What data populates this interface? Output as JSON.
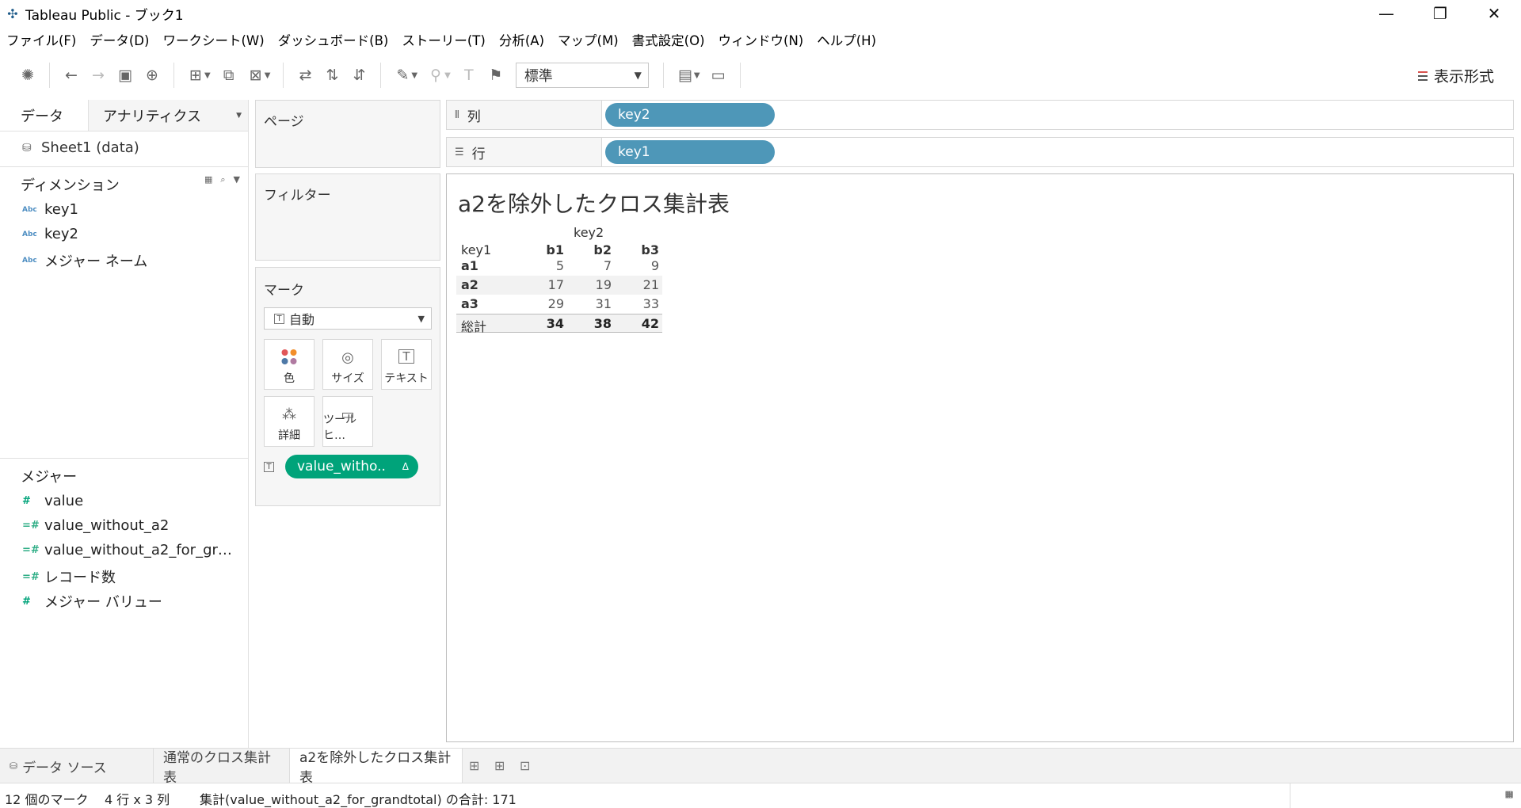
{
  "window": {
    "title": "Tableau Public - ブック1",
    "minimize": "—",
    "restore": "❐",
    "close": "✕"
  },
  "menu": [
    "ファイル(F)",
    "データ(D)",
    "ワークシート(W)",
    "ダッシュボード(B)",
    "ストーリー(T)",
    "分析(A)",
    "マップ(M)",
    "書式設定(O)",
    "ウィンドウ(N)",
    "ヘルプ(H)"
  ],
  "toolbar": {
    "fit_select": "標準",
    "format_label": "表示形式"
  },
  "left_pane": {
    "tabs": [
      "データ",
      "アナリティクス"
    ],
    "datasource": "Sheet1 (data)",
    "dimensions_header": "ディメンション",
    "dimensions": [
      "key1",
      "key2",
      "メジャー ネーム"
    ],
    "abc_badge": "Abc",
    "measures_header": "メジャー",
    "measures": [
      "value",
      "value_without_a2",
      "value_without_a2_for_gr…",
      "レコード数",
      "メジャー バリュー"
    ]
  },
  "cards": {
    "pages": "ページ",
    "filters": "フィルター",
    "marks": "マーク",
    "marks_type": "自動",
    "mark_buttons": [
      "色",
      "サイズ",
      "テキスト",
      "詳細",
      "ツールヒ…"
    ],
    "text_pill": "value_witho..",
    "pill_delta": "Δ"
  },
  "shelves": {
    "columns_label": "列",
    "rows_label": "行",
    "columns_pill": "key2",
    "rows_pill": "key1"
  },
  "view": {
    "title": "a2を除外したクロス集計表",
    "col_field": "key2",
    "row_field": "key1",
    "columns": [
      "b1",
      "b2",
      "b3"
    ],
    "rows": [
      {
        "label": "a1",
        "values": [
          "5",
          "7",
          "9"
        ]
      },
      {
        "label": "a2",
        "values": [
          "17",
          "19",
          "21"
        ]
      },
      {
        "label": "a3",
        "values": [
          "29",
          "31",
          "33"
        ]
      }
    ],
    "total": {
      "label": "総計",
      "values": [
        "34",
        "38",
        "42"
      ]
    }
  },
  "sheet_tabs": {
    "datasource": "データ ソース",
    "sheets": [
      "通常のクロス集計表",
      "a2を除外したクロス集計表"
    ]
  },
  "status": {
    "marks": "12 個のマーク",
    "dims": "4 行 x 3 列",
    "sum": "集計(value_without_a2_for_grandtotal) の合計: 171"
  }
}
